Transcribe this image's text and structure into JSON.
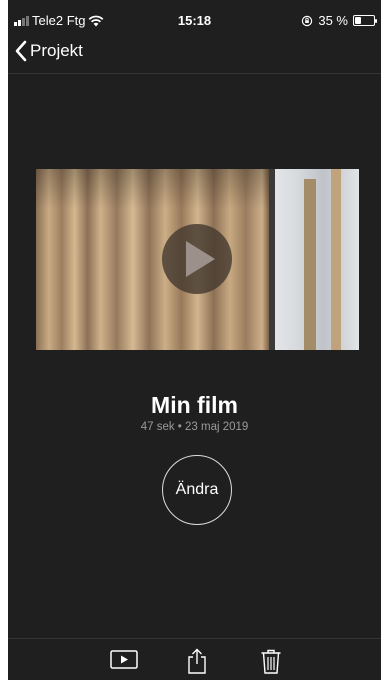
{
  "status_bar": {
    "carrier": "Tele2 Ftg",
    "time": "15:18",
    "battery_percent": "35 %",
    "battery_level": 0.35,
    "icons": [
      "signal-icon",
      "wifi-icon",
      "orientation-lock-icon",
      "battery-icon"
    ]
  },
  "nav": {
    "back_label": "Projekt",
    "back_icon": "chevron-left-icon"
  },
  "video": {
    "play_icon": "play-icon"
  },
  "film": {
    "title": "Min film",
    "meta": "47 sek • 23 maj 2019"
  },
  "edit_button": {
    "label": "Ändra"
  },
  "toolbar": {
    "icons": [
      "play-preview-icon",
      "share-icon",
      "trash-icon"
    ]
  },
  "colors": {
    "background": "#1f1f1f",
    "text": "#ffffff",
    "meta_text": "#9a9a9a"
  }
}
